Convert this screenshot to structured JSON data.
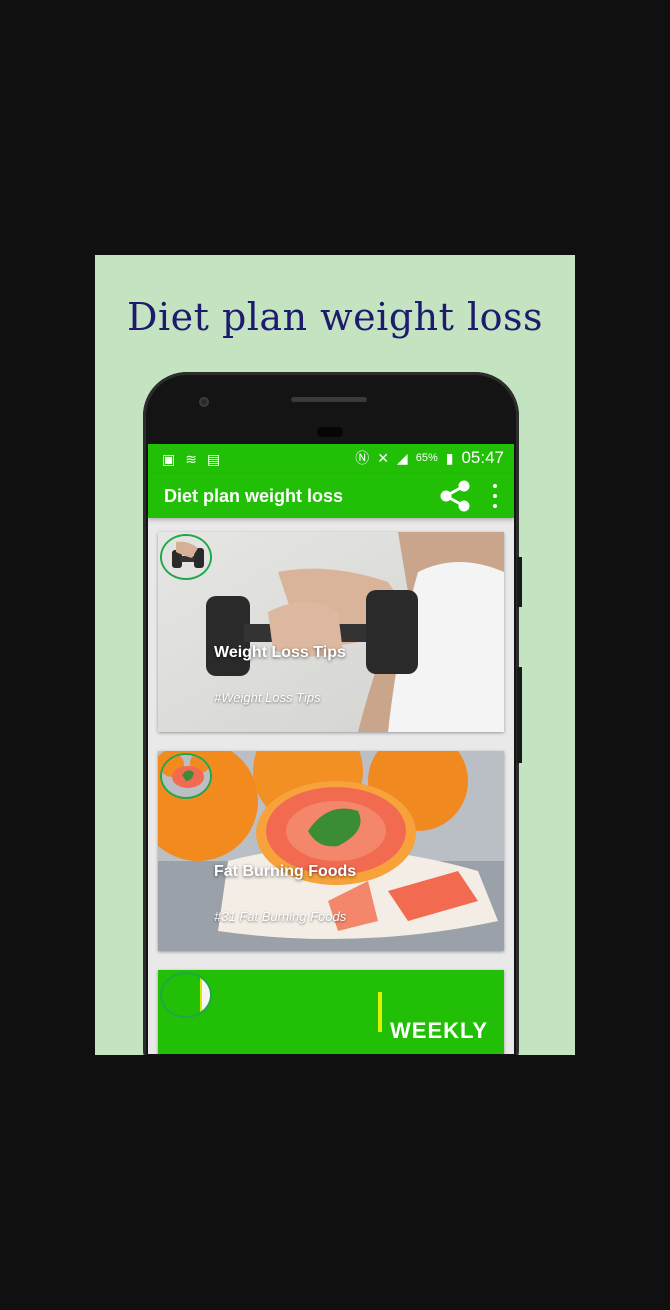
{
  "promo": {
    "title": "Diet plan weight loss"
  },
  "status_bar": {
    "battery": "65%",
    "time": "05:47"
  },
  "app_bar": {
    "title": "Diet plan weight loss"
  },
  "cards": [
    {
      "title": "Weight Loss Tips",
      "tag": "#Weight Loss Tips"
    },
    {
      "title": "Fat Burning Foods",
      "tag": "#31 Fat Burning Foods"
    },
    {
      "banner_text": "WEEKLY"
    }
  ],
  "colors": {
    "accent": "#21bf05",
    "promo_bg": "#c4e3c0",
    "promo_title": "#1c1b6e"
  }
}
